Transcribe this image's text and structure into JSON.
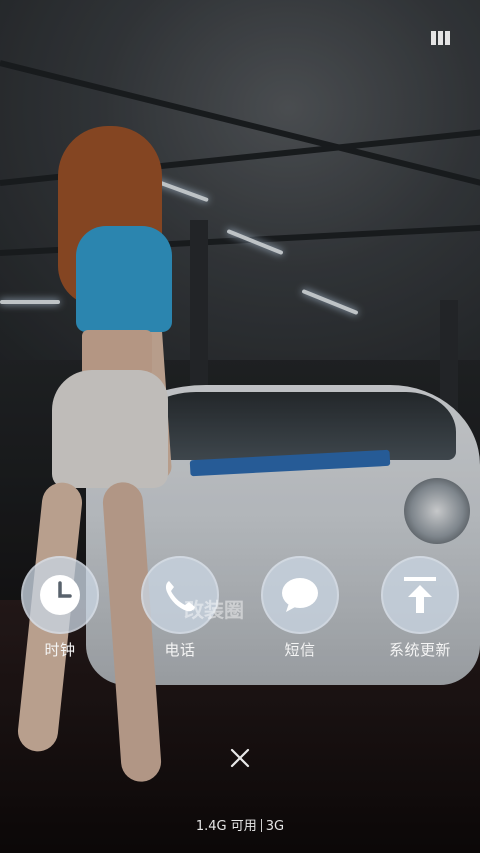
{
  "apps": [
    {
      "label": "时钟",
      "icon": "clock-icon"
    },
    {
      "label": "电话",
      "icon": "phone-icon"
    },
    {
      "label": "短信",
      "icon": "message-icon"
    },
    {
      "label": "系统更新",
      "icon": "system-update-icon"
    }
  ],
  "watermark": "改装圈",
  "status": {
    "storage_available": "1.4G 可用",
    "network": "3G"
  },
  "colors": {
    "icon_circle": "#c8d4e0",
    "label_text": "#f4f4f4"
  }
}
